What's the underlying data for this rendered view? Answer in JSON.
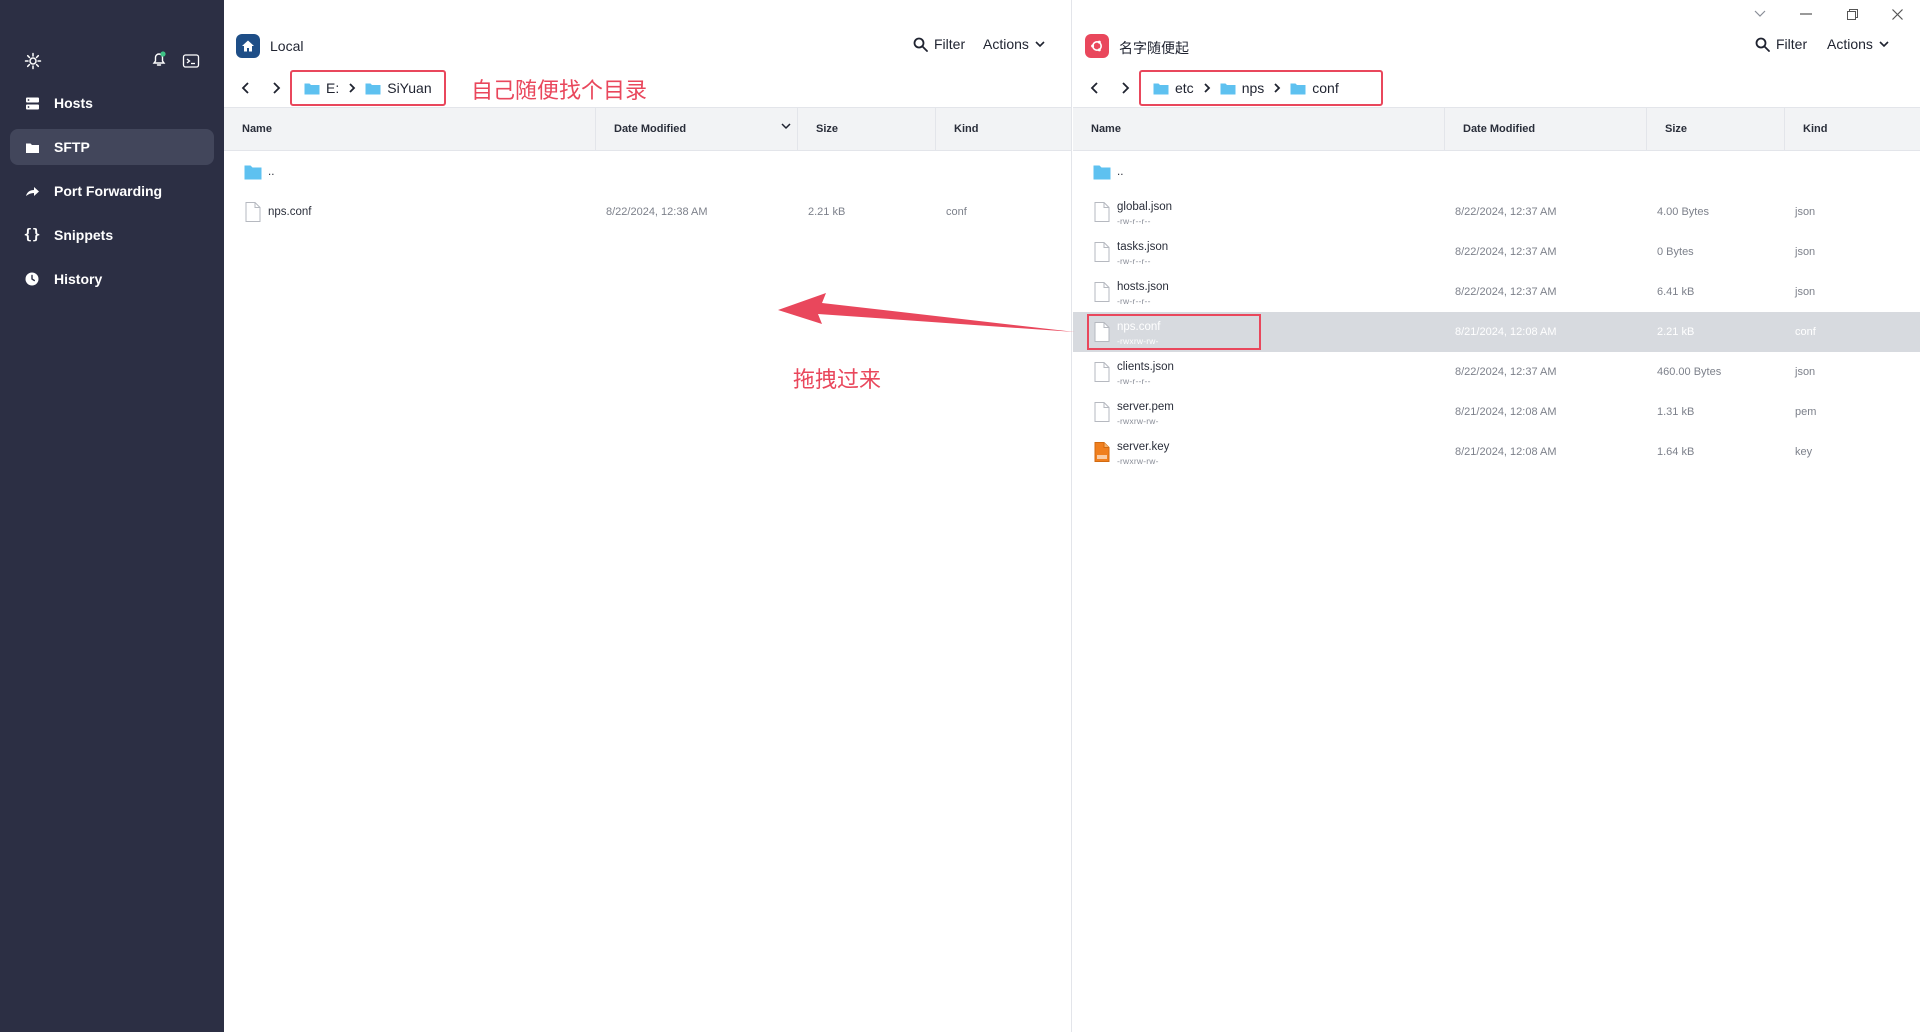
{
  "sidebar": {
    "items": [
      {
        "label": "Hosts",
        "icon": "hosts-icon",
        "active": false
      },
      {
        "label": "SFTP",
        "icon": "folder-icon",
        "active": true
      },
      {
        "label": "Port Forwarding",
        "icon": "forward-arrow-icon",
        "active": false
      },
      {
        "label": "Snippets",
        "icon": "braces-icon",
        "active": false
      },
      {
        "label": "History",
        "icon": "clock-icon",
        "active": false
      }
    ]
  },
  "local": {
    "title": "Local",
    "filter_label": "Filter",
    "actions_label": "Actions",
    "breadcrumb": [
      "E:",
      "SiYuan"
    ],
    "annotation": "自己随便找个目录",
    "columns": [
      "Name",
      "Date Modified",
      "Size",
      "Kind"
    ],
    "parent_label": "..",
    "files": [
      {
        "name": "nps.conf",
        "modified": "8/22/2024, 12:38 AM",
        "size": "2.21 kB",
        "kind": "conf"
      }
    ]
  },
  "remote": {
    "title": "名字随便起",
    "filter_label": "Filter",
    "actions_label": "Actions",
    "breadcrumb": [
      "etc",
      "nps",
      "conf"
    ],
    "columns": [
      "Name",
      "Date Modified",
      "Size",
      "Kind"
    ],
    "parent_label": "..",
    "files": [
      {
        "name": "global.json",
        "perm": "-rw-r--r--",
        "modified": "8/22/2024, 12:37 AM",
        "size": "4.00 Bytes",
        "kind": "json",
        "selected": false
      },
      {
        "name": "tasks.json",
        "perm": "-rw-r--r--",
        "modified": "8/22/2024, 12:37 AM",
        "size": "0 Bytes",
        "kind": "json",
        "selected": false
      },
      {
        "name": "hosts.json",
        "perm": "-rw-r--r--",
        "modified": "8/22/2024, 12:37 AM",
        "size": "6.41 kB",
        "kind": "json",
        "selected": false
      },
      {
        "name": "nps.conf",
        "perm": "-rwxrw-rw-",
        "modified": "8/21/2024, 12:08 AM",
        "size": "2.21 kB",
        "kind": "conf",
        "selected": true
      },
      {
        "name": "clients.json",
        "perm": "-rw-r--r--",
        "modified": "8/22/2024, 12:37 AM",
        "size": "460.00 Bytes",
        "kind": "json",
        "selected": false
      },
      {
        "name": "server.pem",
        "perm": "-rwxrw-rw-",
        "modified": "8/21/2024, 12:08 AM",
        "size": "1.31 kB",
        "kind": "pem",
        "selected": false
      },
      {
        "name": "server.key",
        "perm": "-rwxrw-rw-",
        "modified": "8/21/2024, 12:08 AM",
        "size": "1.64 kB",
        "kind": "key",
        "selected": false
      }
    ]
  },
  "drag_annotation": "拖拽过来",
  "colors": {
    "sidebar_bg": "#2c2f44",
    "sidebar_active": "#42465b",
    "annotation_red": "#e9475c",
    "local_badge": "#1e4e87",
    "remote_badge": "#e9475c",
    "folder_blue": "#5ec1f0",
    "selected_row": "#d7dadf"
  }
}
